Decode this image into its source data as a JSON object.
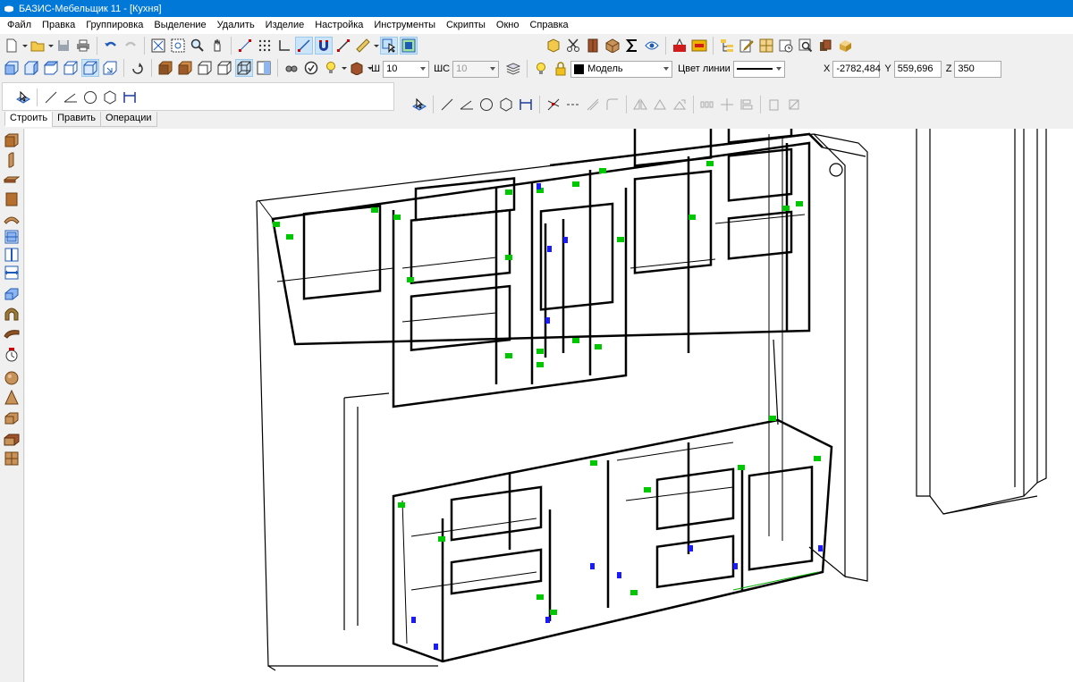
{
  "window": {
    "title": "БАЗИС-Мебельщик 11 - [Кухня]"
  },
  "menu": [
    "Файл",
    "Правка",
    "Группировка",
    "Выделение",
    "Удалить",
    "Изделие",
    "Настройка",
    "Инструменты",
    "Скрипты",
    "Окно",
    "Справка"
  ],
  "props": {
    "w_label": "Ш",
    "w_value": "10",
    "ws_label": "ШС",
    "ws_value": "10",
    "layer_value": "Модель",
    "line_color_label": "Цвет линии"
  },
  "coords": {
    "x_label": "X",
    "x_value": "-2782,484",
    "y_label": "Y",
    "y_value": "559,696",
    "z_label": "Z",
    "z_value": "350"
  },
  "tabs": [
    "Строить",
    "Править",
    "Операции"
  ],
  "colors": {
    "titlebar": "#0078d7",
    "highlight": "#00c800",
    "marker": "#1a1aff"
  }
}
